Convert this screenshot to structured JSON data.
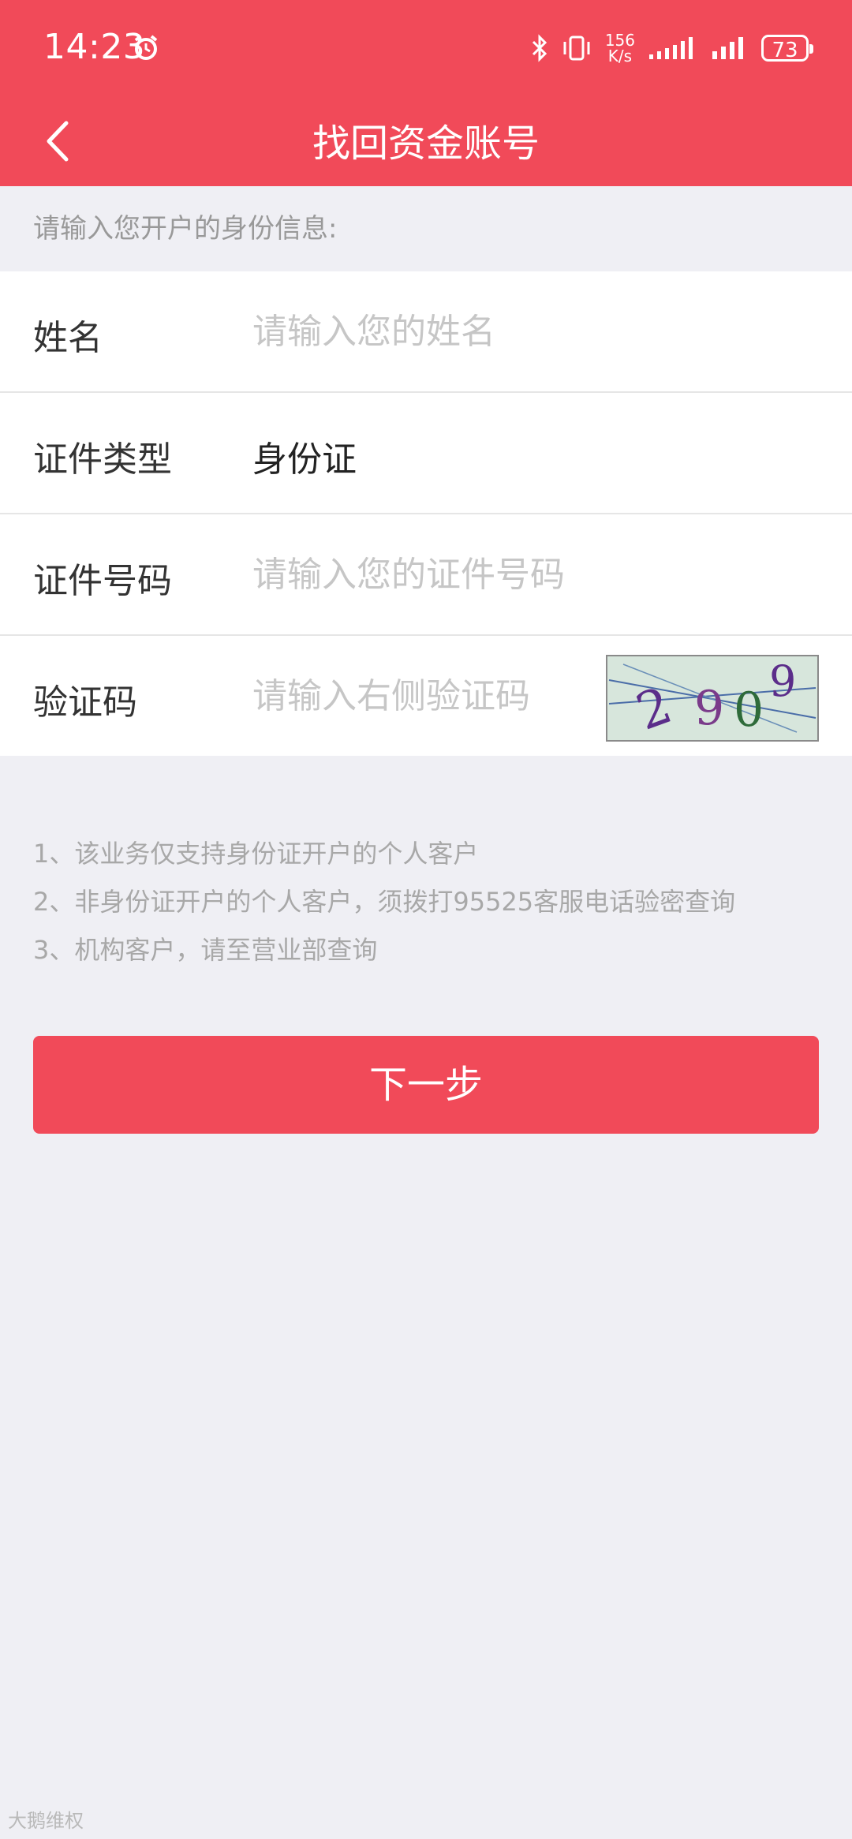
{
  "status_bar": {
    "time": "14:23",
    "network_speed_value": "156",
    "network_speed_unit": "K/s",
    "battery": "73"
  },
  "header": {
    "title": "找回资金账号"
  },
  "hint": "请输入您开户的身份信息:",
  "form": {
    "name": {
      "label": "姓名",
      "placeholder": "请输入您的姓名"
    },
    "id_type": {
      "label": "证件类型",
      "value": "身份证"
    },
    "id_number": {
      "label": "证件号码",
      "placeholder": "请输入您的证件号码"
    },
    "captcha": {
      "label": "验证码",
      "placeholder": "请输入右侧验证码",
      "image_text": "2909"
    }
  },
  "notes": [
    "1、该业务仅支持身份证开户的个人客户",
    "2、非身份证开户的个人客户，须拨打95525客服电话验密查询",
    "3、机构客户，请至营业部查询"
  ],
  "next_button": "下一步",
  "watermark": "大鹅维权",
  "colors": {
    "accent": "#f14a59",
    "background": "#efeff4"
  }
}
